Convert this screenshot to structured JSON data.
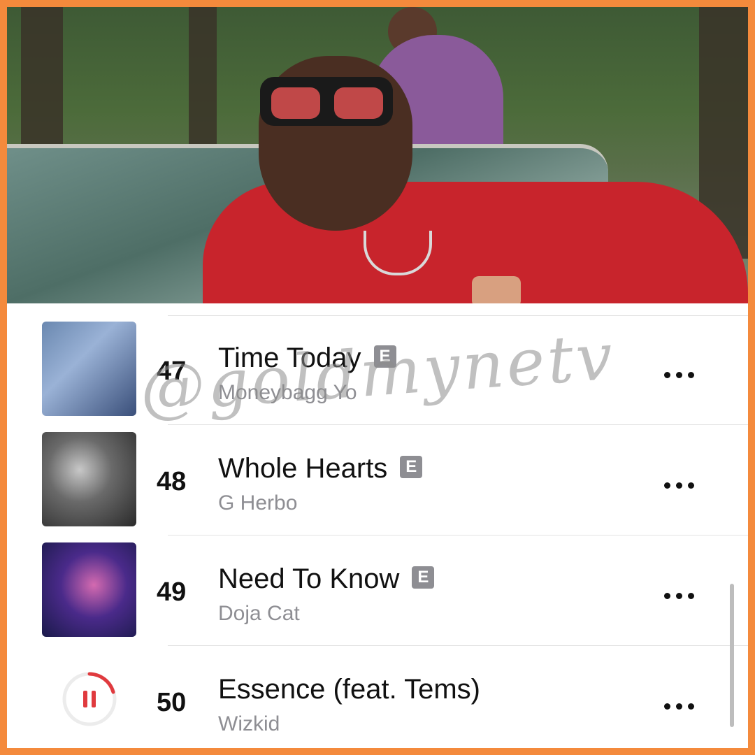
{
  "header": {
    "image_description_icon": "music-video-still"
  },
  "watermark": "@goldmynetv",
  "tracks": [
    {
      "rank": "47",
      "title": "Time Today",
      "artist": "Moneybagg Yo",
      "explicit": "E",
      "more_icon": "ellipsis-icon"
    },
    {
      "rank": "48",
      "title": "Whole Hearts",
      "artist": "G Herbo",
      "explicit": "E",
      "more_icon": "ellipsis-icon"
    },
    {
      "rank": "49",
      "title": "Need To Know",
      "artist": "Doja Cat",
      "explicit": "E",
      "more_icon": "ellipsis-icon"
    },
    {
      "rank": "50",
      "title": "Essence (feat. Tems)",
      "artist": "Wizkid",
      "explicit": "",
      "more_icon": "ellipsis-icon",
      "playback_icon": "pause-icon"
    }
  ],
  "colors": {
    "border": "#f48a3c",
    "accent": "#e03a3e",
    "secondary_text": "#8e8e93"
  }
}
